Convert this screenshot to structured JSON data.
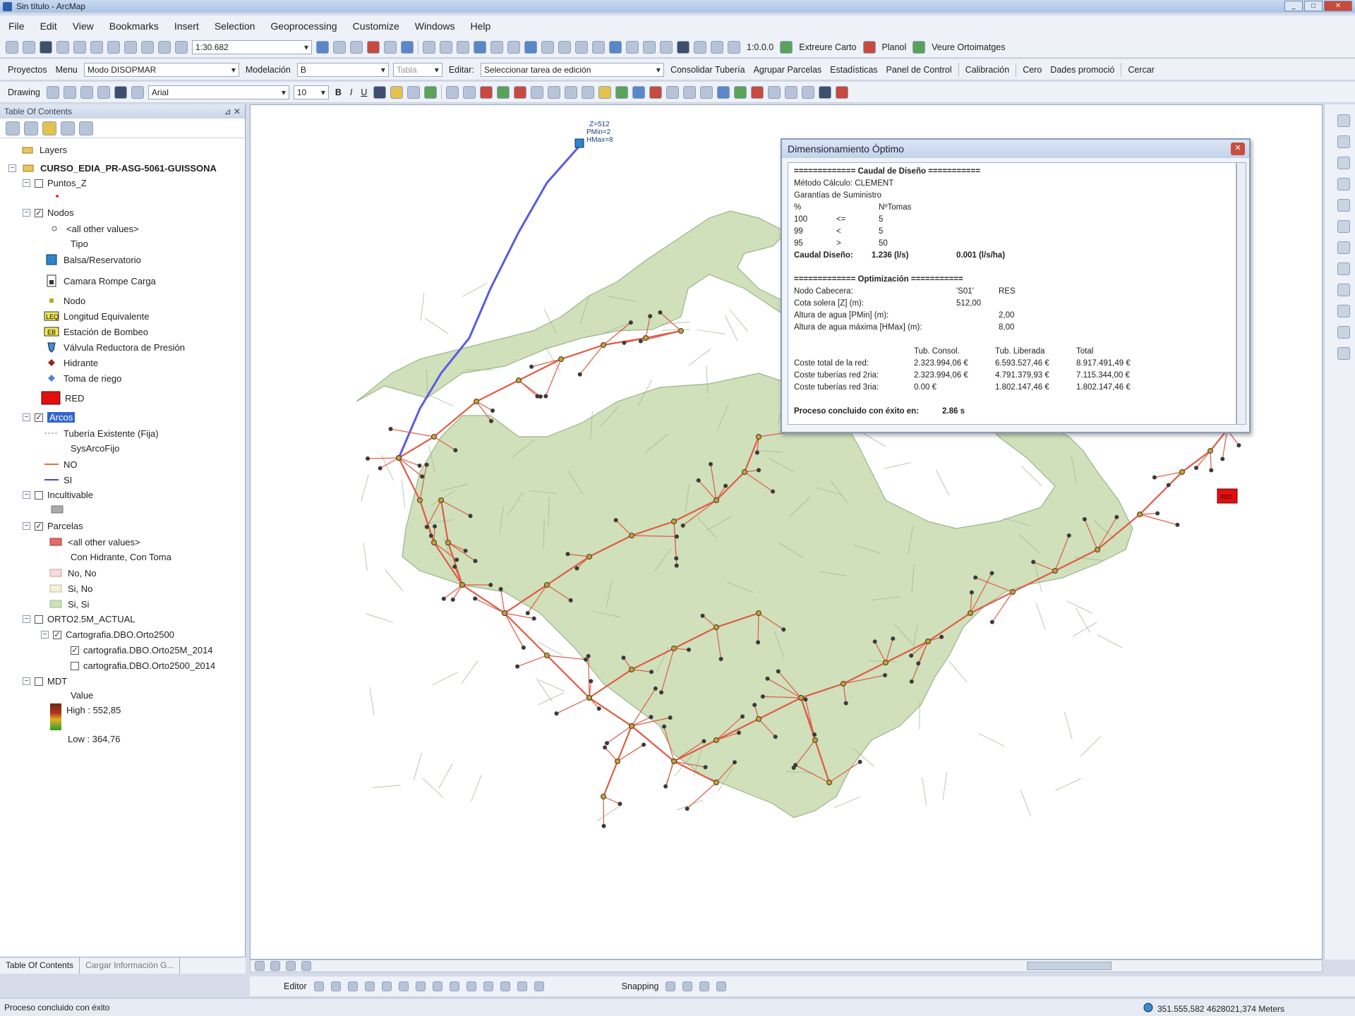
{
  "window": {
    "title": "Sin título - ArcMap"
  },
  "menu": [
    "File",
    "Edit",
    "View",
    "Bookmarks",
    "Insert",
    "Selection",
    "Geoprocessing",
    "Customize",
    "Windows",
    "Help"
  ],
  "toolbar1": {
    "scale": "1:30.682",
    "right_tools": [
      "1:0.0.0",
      "Extreure Carto",
      "Planol",
      "Veure Ortoimatges"
    ]
  },
  "toolbar2": {
    "items": [
      "Proyectos",
      "Menu",
      "Modelación",
      "Editar:",
      "Consolidar Tubería",
      "Agrupar Parcelas",
      "Estadísticas",
      "Panel de Control",
      "Calibración",
      "Cero",
      "Dades promoció",
      "Cercar"
    ],
    "menu_combo": "Modo DISOPMAR",
    "modelacion_combo": "B",
    "table_combo": "Tabla",
    "editar_combo": "Seleccionar tarea de edición"
  },
  "toolbar3": {
    "drawing": "Drawing",
    "font": "Arial",
    "size": "10",
    "bold": "B",
    "italic": "I",
    "underline": "U"
  },
  "toc": {
    "title": "Table Of Contents",
    "items": [
      {
        "label": "Layers"
      },
      {
        "label": "CURSO_EDIA_PR-ASG-5061-GUISSONA"
      },
      {
        "label": "Puntos_Z"
      },
      {
        "label": "Nodos"
      },
      {
        "label": "<all other values>"
      },
      {
        "label": "Tipo"
      },
      {
        "label": "Balsa/Reservatorio"
      },
      {
        "label": "Camara Rompe Carga"
      },
      {
        "label": "Nodo"
      },
      {
        "label": "Longitud Equivalente"
      },
      {
        "label": "Estación de Bombeo"
      },
      {
        "label": "Válvula Reductora de Presión"
      },
      {
        "label": "Hidrante"
      },
      {
        "label": "Toma de riego"
      },
      {
        "label": "RED"
      },
      {
        "label": "Arcos"
      },
      {
        "label": "Tubería Existente (Fija)"
      },
      {
        "label": "SysArcoFijo"
      },
      {
        "label": "NO"
      },
      {
        "label": "SI"
      },
      {
        "label": "Incultivable"
      },
      {
        "label": "Parcelas"
      },
      {
        "label": "<all other values>"
      },
      {
        "label": "Con Hidrante, Con Toma"
      },
      {
        "label": "No, No"
      },
      {
        "label": "Si, No"
      },
      {
        "label": "Si, Si"
      },
      {
        "label": "ORTO2.5M_ACTUAL"
      },
      {
        "label": "Cartografia.DBO.Orto2500"
      },
      {
        "label": "cartografia.DBO.Orto25M_2014"
      },
      {
        "label": "cartografia.DBO.Orto2500_2014"
      },
      {
        "label": "MDT"
      },
      {
        "label": "Value"
      },
      {
        "label": "High : 552,85"
      },
      {
        "label": "Low : 364,76"
      }
    ],
    "tabs": [
      "Table Of Contents",
      "Cargar Información G..."
    ]
  },
  "map": {
    "reservoir_label": [
      "Z=512",
      "PMin=2",
      "HMax=8"
    ],
    "red_label": "RED",
    "colors": {
      "parcel_fill": "#cfe0bb",
      "parcel_stroke": "#9fb38c",
      "pipe_no": "#e05a45",
      "pipe_si": "#5a5ae6",
      "node": "#3b3b3b"
    }
  },
  "dialog": {
    "title": "Dimensionamiento Óptimo",
    "caudal_header": "============= Caudal de Diseño ===========",
    "metodo": "Método Cálculo: CLEMENT",
    "garantias": "Garantías de Suministro",
    "cols": [
      "%",
      "",
      "NºTomas"
    ],
    "rows": [
      [
        "100",
        "<=",
        "5"
      ],
      [
        "99",
        "<",
        "5"
      ],
      [
        "95",
        ">",
        "50"
      ]
    ],
    "caudal_label": "Caudal Diseño:",
    "caudal_ls": "1.236 (l/s)",
    "caudal_lsha": "0.001 (l/s/ha)",
    "opt_header": "============= Optimización ===========",
    "nodo_label": "Nodo Cabecera:",
    "nodo_v1": "'S01'",
    "nodo_v2": "RES",
    "cota_label": "Cota solera [Z] (m):",
    "cota_v": "512,00",
    "pmin_label": "Altura de agua [PMin] (m):",
    "pmin_v": "2,00",
    "hmax_label": "Altura de agua máxima [HMax] (m):",
    "hmax_v": "8,00",
    "cost_cols": [
      "Tub. Consol.",
      "Tub. Liberada",
      "Total"
    ],
    "costs": [
      {
        "label": "Coste total de la red:",
        "c": "2.323.994,06 €",
        "l": "6.593.527,46 €",
        "t": "8.917.491,49 €"
      },
      {
        "label": "Coste tuberías red 2ria:",
        "c": "2.323.994,06 €",
        "l": "4.791.379,93 €",
        "t": "7.115.344,00 €"
      },
      {
        "label": "Coste tuberías red 3ria:",
        "c": "0.00 €",
        "l": "1.802.147,46 €",
        "t": "1.802.147,46 €"
      }
    ],
    "proceso_label": "Proceso concluido con éxito en:",
    "proceso_time": "2.86 s"
  },
  "editor": {
    "editor": "Editor",
    "snapping": "Snapping"
  },
  "status": {
    "message": "Proceso concluido con éxito",
    "coords": "351.555,582  4628021,374 Meters"
  }
}
